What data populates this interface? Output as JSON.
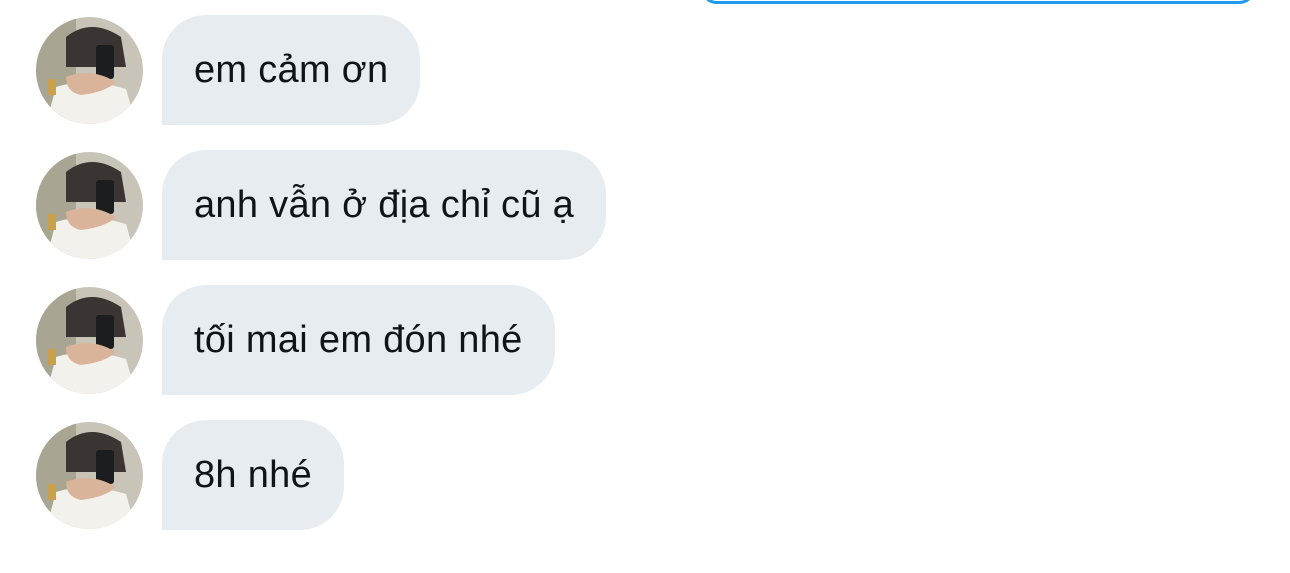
{
  "conversation": {
    "messages": [
      {
        "text": "em cảm ơn"
      },
      {
        "text": "anh vẫn ở địa chỉ cũ ạ"
      },
      {
        "text": "tối mai em đón nhé"
      },
      {
        "text": "8h nhé"
      }
    ]
  },
  "colors": {
    "received_bubble": "#e7ecf0",
    "text": "#0f1419",
    "sent_bubble_border": "#1d9bf0"
  },
  "icons": {
    "avatar": "profile-photo-avatar"
  }
}
